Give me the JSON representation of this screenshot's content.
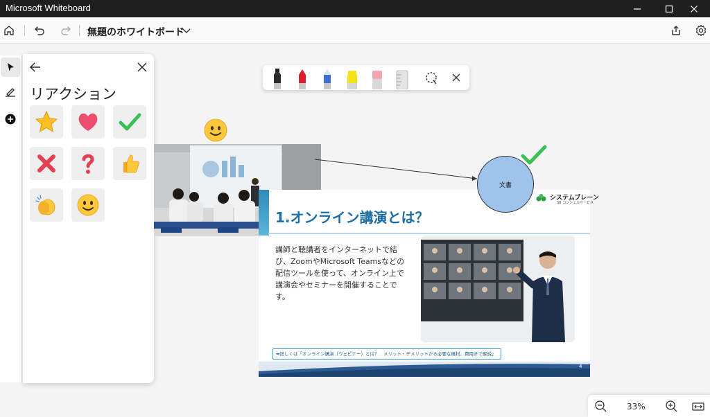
{
  "window": {
    "app_title": "Microsoft Whiteboard",
    "minimize_icon": "minimize-icon",
    "maximize_icon": "maximize-icon",
    "close_icon": "close-icon"
  },
  "toolbar": {
    "board_title": "無題のホワイトボード",
    "icons": [
      "home-icon",
      "undo-icon",
      "redo-icon",
      "chevron-down-icon",
      "share-icon",
      "settings-icon"
    ]
  },
  "rail": {
    "tools": [
      "select-icon",
      "ink-icon",
      "add-icon"
    ]
  },
  "reactions_panel": {
    "title": "リアクション",
    "items": [
      "star",
      "heart",
      "checkmark",
      "cross",
      "question",
      "thumbs-up",
      "clapping-hands",
      "smiley"
    ]
  },
  "pen_palette": {
    "tools": [
      "black-pen",
      "red-pen",
      "blue-pen",
      "yellow-highlighter",
      "eraser",
      "ruler",
      "lasso-select",
      "close"
    ],
    "colors": {
      "black": "#222222",
      "red": "#d8202c",
      "blue": "#3f6fd0",
      "highlighter": "#f2e21a",
      "eraser": "#f1a8b2"
    }
  },
  "slide": {
    "heading": "1.オンライン講演とは？",
    "body": "講師と聴講者をインターネットで結び、ZoomやMicrosoft Teamsなどの配信ツールを使って、オンライン上で講演会やセミナーを開催することです。",
    "link": "➡詳しくは「オンライン講演（ウェビナー）とは？　メリット・デメリットから必要な機材、費用まで解説」",
    "page_number": "4",
    "logo_name": "システムブレーン",
    "logo_sub": "SB コンシェルサービス"
  },
  "shapes": {
    "circle_label": "文書",
    "circle_color": "#9fc3ea",
    "check_color": "#3cbf55"
  },
  "zoom": {
    "level": "33%",
    "icons": [
      "zoom-out-icon",
      "zoom-in-icon",
      "fit-to-screen-icon"
    ]
  },
  "colors": {
    "titlebar": "#1f1f1f",
    "canvas": "#f4f4f4",
    "slide_heading": "#1c6ea4"
  }
}
